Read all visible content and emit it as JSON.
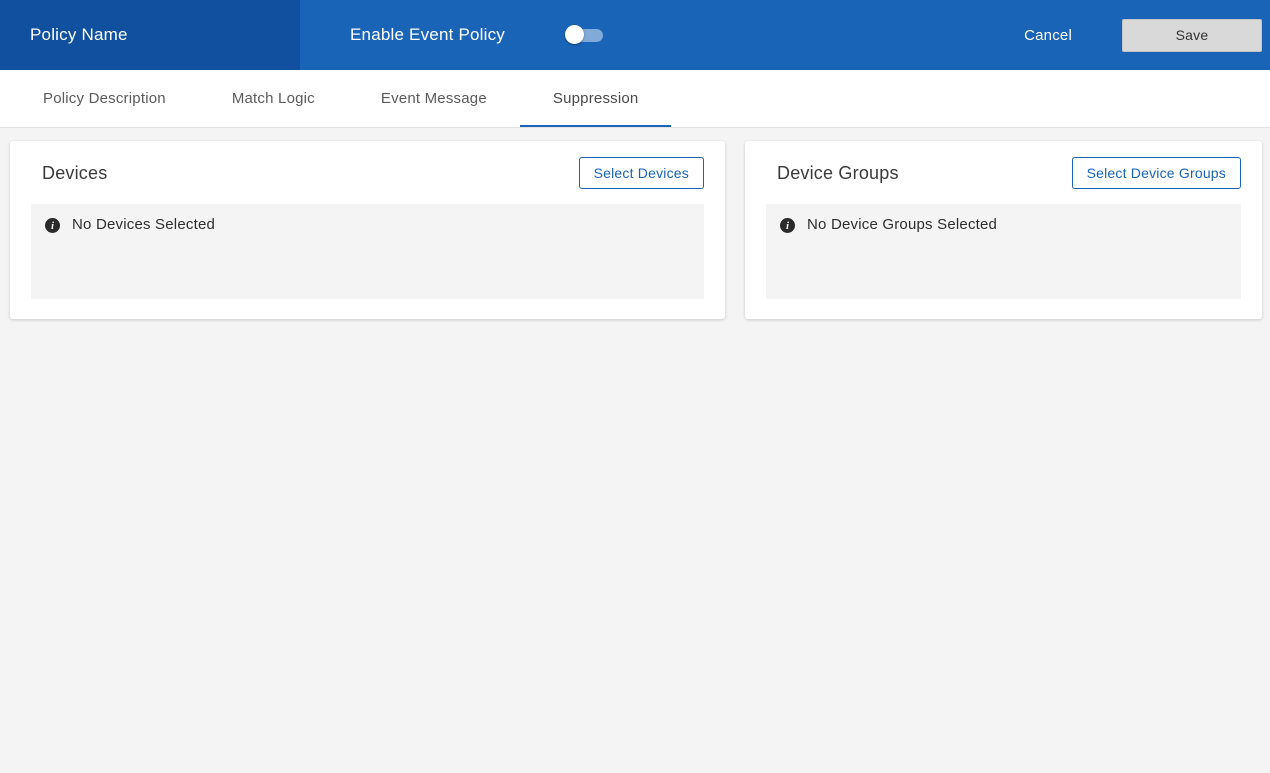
{
  "header": {
    "policy_name": "Policy Name",
    "enable_label": "Enable Event Policy",
    "toggle_state": "off",
    "cancel_label": "Cancel",
    "save_label": "Save",
    "colors": {
      "bar_background": "#1a64b8",
      "bar_left_background": "#11509f",
      "save_button_background": "#d9d9d9"
    }
  },
  "tabs": [
    {
      "label": "Policy Description",
      "active": false
    },
    {
      "label": "Match Logic",
      "active": false
    },
    {
      "label": "Event Message",
      "active": false
    },
    {
      "label": "Suppression",
      "active": true
    }
  ],
  "panels": {
    "devices": {
      "title": "Devices",
      "button_label": "Select Devices",
      "empty_icon": "info-icon",
      "empty_message": "No Devices Selected"
    },
    "device_groups": {
      "title": "Device Groups",
      "button_label": "Select Device Groups",
      "empty_icon": "info-icon",
      "empty_message": "No Device Groups Selected"
    }
  },
  "accent_color": "#1a64b8"
}
